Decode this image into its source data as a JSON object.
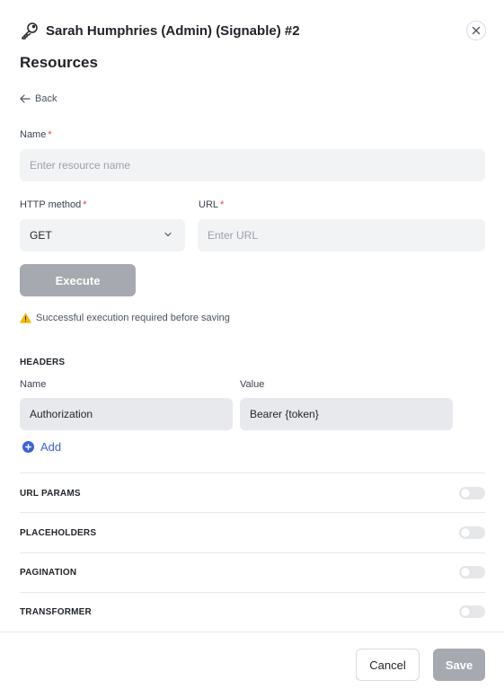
{
  "header": {
    "title": "Sarah Humphries (Admin) (Signable) #2",
    "icon": "key-icon",
    "close_icon": "close-icon"
  },
  "section_title": "Resources",
  "back_label": "Back",
  "form": {
    "name_label": "Name",
    "name_placeholder": "Enter resource name",
    "name_value": "",
    "method_label": "HTTP method",
    "method_value": "GET",
    "url_label": "URL",
    "url_placeholder": "Enter URL",
    "url_value": "",
    "required_mark": "*"
  },
  "execute_label": "Execute",
  "warning_text": "Successful execution required before saving",
  "headers": {
    "title": "HEADERS",
    "name_col": "Name",
    "value_col": "Value",
    "rows": [
      {
        "name": "Authorization",
        "value": "Bearer {token}"
      }
    ],
    "add_label": "Add"
  },
  "sections": [
    {
      "label": "URL PARAMS",
      "enabled": false
    },
    {
      "label": "PLACEHOLDERS",
      "enabled": false
    },
    {
      "label": "PAGINATION",
      "enabled": false
    },
    {
      "label": "TRANSFORMER",
      "enabled": false
    }
  ],
  "footer": {
    "cancel_label": "Cancel",
    "save_label": "Save"
  },
  "colors": {
    "accent": "#3b63d6",
    "required": "#d9473b",
    "warning": "#f2b705",
    "disabled_button": "#a6a9af"
  }
}
